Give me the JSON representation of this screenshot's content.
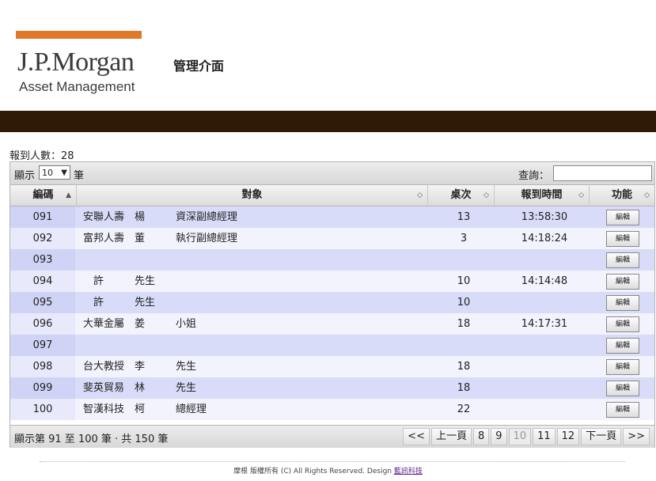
{
  "brand": {
    "logo_main": "J.P.Morgan",
    "logo_sub": "Asset Management",
    "accent_color": "#e0782a",
    "band_color": "#2e1a06"
  },
  "page_title": "管理介面",
  "summary": {
    "label": "報到人數：",
    "value": "28"
  },
  "toolbar": {
    "show_label": "顯示",
    "show_value": "10",
    "unit_label": "筆",
    "search_label": "查詢：",
    "search_value": ""
  },
  "table": {
    "headers": [
      "編碼",
      "對象",
      "桌次",
      "報到時間",
      "功能"
    ],
    "edit_label": "編輯",
    "rows": [
      {
        "code": "091",
        "target": "安聯人壽　楊　　　資深副總經理",
        "table": "13",
        "time": "13:58:30"
      },
      {
        "code": "092",
        "target": "富邦人壽　董　　　執行副總經理",
        "table": "3",
        "time": "14:18:24"
      },
      {
        "code": "093",
        "target": "",
        "table": "",
        "time": ""
      },
      {
        "code": "094",
        "target": "　許　　　先生",
        "table": "10",
        "time": "14:14:48"
      },
      {
        "code": "095",
        "target": "　許　　　先生",
        "table": "10",
        "time": ""
      },
      {
        "code": "096",
        "target": "大華金屬　姜　　　小姐",
        "table": "18",
        "time": "14:17:31"
      },
      {
        "code": "097",
        "target": "",
        "table": "",
        "time": ""
      },
      {
        "code": "098",
        "target": "台大教授　李　　　先生",
        "table": "18",
        "time": ""
      },
      {
        "code": "099",
        "target": "斐英貿易　林　　　先生",
        "table": "18",
        "time": ""
      },
      {
        "code": "100",
        "target": "智漢科技　柯　　　總經理",
        "table": "22",
        "time": ""
      }
    ]
  },
  "footer": {
    "info": "顯示第 91 至 100 筆 · 共 150 筆",
    "pager": [
      "<<",
      "上一頁",
      "8",
      "9",
      "10",
      "11",
      "12",
      "下一頁",
      ">>"
    ],
    "current_page": "10"
  },
  "copyright": {
    "text": "摩根 版權所有 (C) All Rights Reserved. Design ",
    "link": "藍訊科技"
  }
}
